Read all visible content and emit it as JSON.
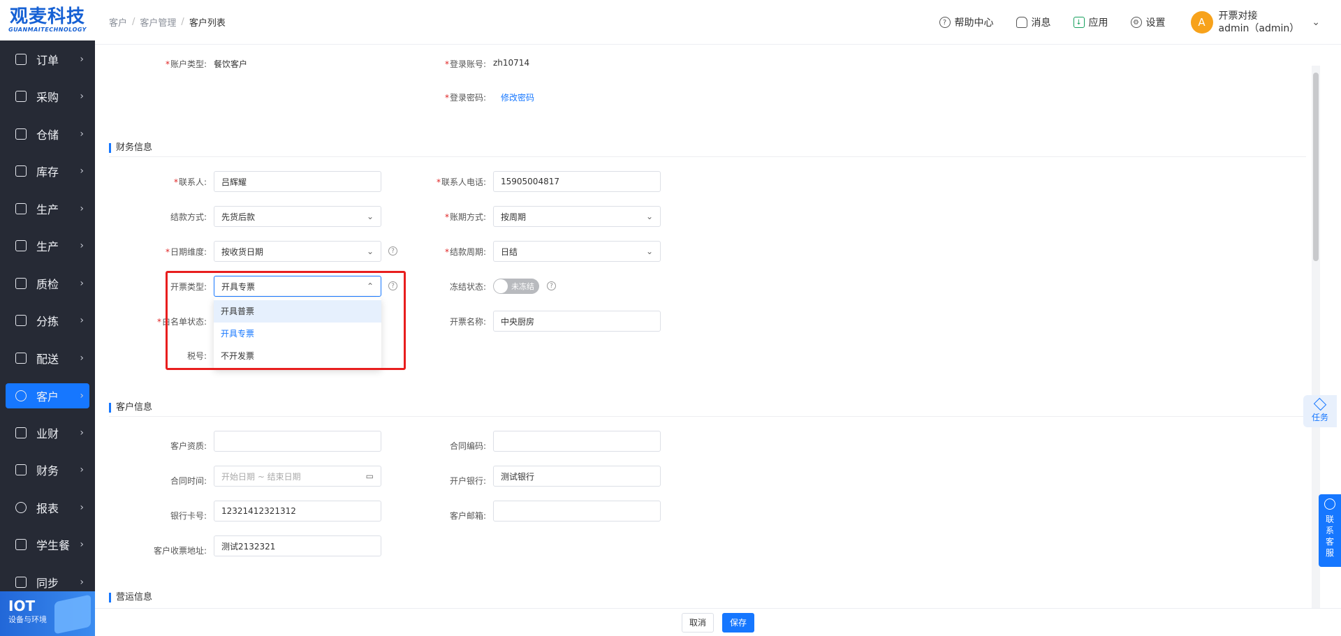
{
  "logo": {
    "main": "观麦科技",
    "sub": "GUANMAITECHNOLOGY"
  },
  "nav": [
    {
      "label": "订单",
      "icon": "order-icon"
    },
    {
      "label": "采购",
      "icon": "purchase-icon"
    },
    {
      "label": "仓储",
      "icon": "warehouse-icon"
    },
    {
      "label": "库存",
      "icon": "inventory-icon"
    },
    {
      "label": "生产",
      "icon": "production-icon"
    },
    {
      "label": "生产",
      "icon": "production-icon"
    },
    {
      "label": "质检",
      "icon": "quality-icon"
    },
    {
      "label": "分拣",
      "icon": "sorting-icon"
    },
    {
      "label": "配送",
      "icon": "delivery-icon"
    },
    {
      "label": "客户",
      "icon": "customer-icon"
    },
    {
      "label": "业财",
      "icon": "business-finance-icon"
    },
    {
      "label": "财务",
      "icon": "finance-icon"
    },
    {
      "label": "报表",
      "icon": "report-icon"
    },
    {
      "label": "学生餐",
      "icon": "student-meal-icon"
    },
    {
      "label": "同步",
      "icon": "sync-icon"
    }
  ],
  "iot": {
    "title": "IOT",
    "sub": "设备与环境"
  },
  "breadcrumb": [
    "客户",
    "客户管理",
    "客户列表"
  ],
  "header": {
    "help": "帮助中心",
    "message": "消息",
    "app": "应用",
    "settings": "设置",
    "avatar": "A",
    "user_name": "开票对接",
    "user_account": "admin（admin）"
  },
  "account": {
    "type_label": "账户类型:",
    "type_value": "餐饮客户",
    "login_label": "登录账号:",
    "login_value": "zh10714",
    "password_label": "登录密码:",
    "password_link": "修改密码"
  },
  "finance": {
    "title": "财务信息",
    "contact_label": "联系人:",
    "contact_value": "吕辉耀",
    "phone_label": "联系人电话:",
    "phone_value": "15905004817",
    "settle_label": "结款方式:",
    "settle_value": "先货后款",
    "period_mode_label": "账期方式:",
    "period_mode_value": "按周期",
    "date_dim_label": "日期维度:",
    "date_dim_value": "按收货日期",
    "settle_cycle_label": "结款周期:",
    "settle_cycle_value": "日结",
    "invoice_type_label": "开票类型:",
    "invoice_type_value": "开具专票",
    "freeze_label": "冻结状态:",
    "freeze_value": "未冻结",
    "whitelist_label": "白名单状态:",
    "invoice_name_label": "开票名称:",
    "invoice_name_value": "中央厨房",
    "tax_label": "税号:",
    "dropdown": [
      "开具普票",
      "开具专票",
      "不开发票"
    ]
  },
  "customer": {
    "title": "客户信息",
    "qualification_label": "客户资质:",
    "contract_code_label": "合同编码:",
    "contract_time_label": "合同时间:",
    "contract_time_placeholder": "开始日期 ~ 结束日期",
    "bank_label": "开户银行:",
    "bank_value": "测试银行",
    "card_label": "银行卡号:",
    "card_value": "12321412321312",
    "email_label": "客户邮箱:",
    "address_label": "客户收票地址:",
    "address_value": "测试2132321"
  },
  "ops": {
    "title": "营运信息"
  },
  "footer": {
    "cancel": "取消",
    "save": "保存"
  },
  "float": {
    "task": "任务",
    "service": [
      "联",
      "系",
      "客",
      "服"
    ]
  }
}
